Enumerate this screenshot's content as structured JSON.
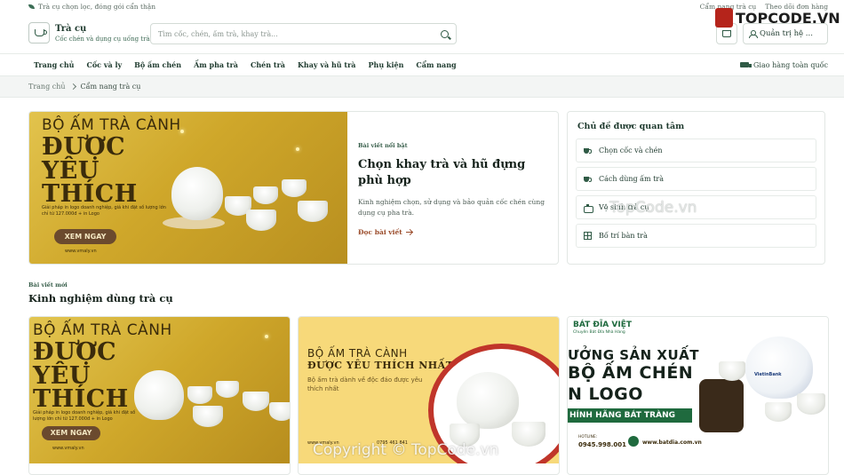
{
  "topbar": {
    "left_text": "Trà cụ chọn lọc, đóng gói cẩn thận",
    "links": [
      "Cẩm nang trà cụ",
      "Theo dõi đơn hàng"
    ]
  },
  "header": {
    "brand_name": "Trà cụ",
    "brand_tagline": "Cốc chén và dụng cụ uống trà",
    "search_placeholder": "Tìm cốc, chén, ấm trà, khay trà...",
    "admin_label": "Quản trị hệ ..."
  },
  "nav": {
    "items": [
      "Trang chủ",
      "Cốc và ly",
      "Bộ ấm chén",
      "Ấm pha trà",
      "Chén trà",
      "Khay và hũ trà",
      "Phụ kiện",
      "Cẩm nang"
    ],
    "shipping": "Giao hàng toàn quốc"
  },
  "breadcrumb": {
    "home": "Trang chủ",
    "current": "Cẩm nang trà cụ"
  },
  "featured": {
    "kicker": "Bài viết nổi bật",
    "title": "Chọn khay trà và hũ đựng phù hợp",
    "description": "Kinh nghiệm chọn, sử dụng và bảo quản cốc chén cùng dụng cụ pha trà.",
    "read_more": "Đọc bài viết",
    "banner": {
      "line1": "BỘ ẤM TRÀ CÀNH",
      "line2": "ĐƯỢC",
      "line3": "YÊU",
      "line4": "THÍCH",
      "small": "Giải pháp in logo doanh nghiệp, giá khi đặt số lượng lớn chỉ từ 127.000đ + in Logo",
      "button": "XEM NGAY",
      "url": "www.vmaly.vn"
    }
  },
  "topics": {
    "heading": "Chủ đề được quan tâm",
    "items": [
      {
        "label": "Chọn cốc và chén",
        "icon": "cup-icon"
      },
      {
        "label": "Cách dùng ấm trà",
        "icon": "cup-icon"
      },
      {
        "label": "Vệ sinh trà cụ",
        "icon": "kettle-icon"
      },
      {
        "label": "Bố trí bàn trà",
        "icon": "grid-icon"
      }
    ]
  },
  "section": {
    "kicker": "Bài viết mới",
    "title": "Kinh nghiệm dùng trà cụ"
  },
  "cards": [
    {
      "line1": "BỘ ẤM TRÀ CÀNH",
      "line2": "ĐƯỢC",
      "line3": "YÊU",
      "line4": "THÍCH",
      "small": "Giải pháp in logo doanh nghiệp, giá khi đặt số lượng lớn chỉ từ 127.000đ + in Logo",
      "button": "XEM NGAY",
      "url": "www.vmaly.vn"
    },
    {
      "line1": "BỘ ẤM TRÀ CÀNH",
      "line2": "ĐƯỢC YÊU THÍCH NHẤT",
      "small": "Bộ ấm trà dành về độc đáo được yêu thích nhất",
      "url": "www.vmaly.vn",
      "phone": "0795 461 841"
    },
    {
      "brand": "BÁT ĐĨA VIỆT",
      "brand_sub": "Chuyên Bát Đĩa Nhà Hàng",
      "line1": "ƯỞNG SẢN XUẤT",
      "line2": "BỘ ẤM CHÉN",
      "line3": "N LOGO",
      "stripe": "HÍNH HÃNG BÁT TRÀNG",
      "hotline_label": "HOTLINE:",
      "hotline": "0945.998.001",
      "website": "www.batdia.com.vn",
      "pot_label": "VietinBank"
    }
  ],
  "watermarks": {
    "topcode_logo": "TOPCODE.VN",
    "center": "TopCode.vn",
    "bottom": "Copyright © TopCode.vn"
  }
}
